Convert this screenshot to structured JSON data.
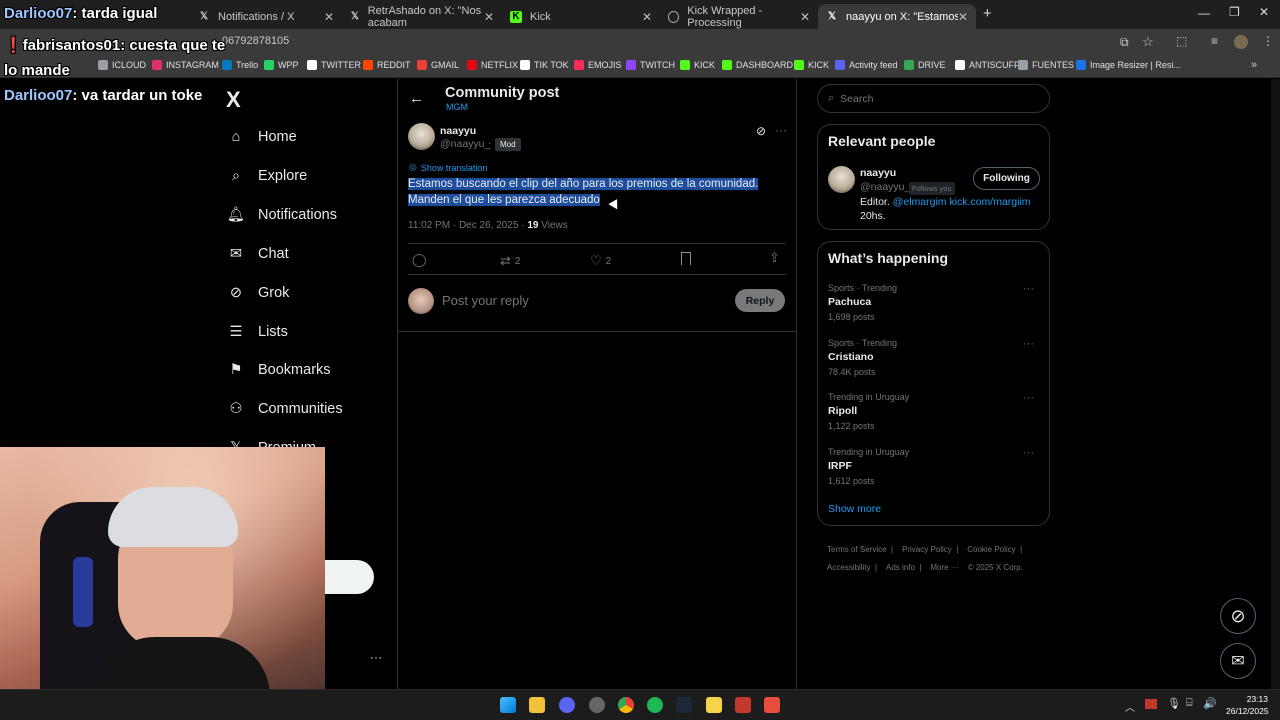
{
  "browser": {
    "tabs": [
      {
        "title": "Notifications / X",
        "icon": "x-icon"
      },
      {
        "title": "RetrAshado on X: \"Nos acabam",
        "icon": "x-icon"
      },
      {
        "title": "Kick",
        "icon": "kick-icon"
      },
      {
        "title": "Kick Wrapped - Processing",
        "icon": "globe-icon"
      },
      {
        "title": "naayyu on X: \"Estamos buscand",
        "icon": "x-icon"
      }
    ],
    "new_tab": "+",
    "url": "06792878105",
    "bookmarks": [
      {
        "label": "ICLOUD",
        "color": "#9aa0a6"
      },
      {
        "label": "INSTAGRAM",
        "color": "#e1306c"
      },
      {
        "label": "Trello",
        "color": "#0079bf"
      },
      {
        "label": "WPP",
        "color": "#25d366"
      },
      {
        "label": "TWITTER",
        "color": "#ffffff"
      },
      {
        "label": "REDDIT",
        "color": "#ff4500"
      },
      {
        "label": "GMAIL",
        "color": "#ea4335"
      },
      {
        "label": "NETFLIX",
        "color": "#e50914"
      },
      {
        "label": "TIK TOK",
        "color": "#ffffff"
      },
      {
        "label": "EMOJIS",
        "color": "#ff2d55"
      },
      {
        "label": "TWITCH",
        "color": "#9146ff"
      },
      {
        "label": "KICK",
        "color": "#53fc18"
      },
      {
        "label": "DASHBOARD",
        "color": "#53fc18"
      },
      {
        "label": "KICK",
        "color": "#53fc18"
      },
      {
        "label": "Activity feed",
        "color": "#5865f2"
      },
      {
        "label": "DRIVE",
        "color": "#34a853"
      },
      {
        "label": "ANTISCUFF",
        "color": "#ffffff"
      },
      {
        "label": "FUENTES",
        "color": "#9aa0a6"
      },
      {
        "label": "Image Resizer | Resi...",
        "color": "#1a73e8"
      }
    ]
  },
  "chat_overlay": [
    {
      "user": "Darlioo07",
      "message": "tarda igual"
    },
    {
      "user": "fabrisantos01",
      "message": "cuesta que te lo mande"
    },
    {
      "user": "Darlioo07",
      "message": "va tardar un toke"
    }
  ],
  "sidebar": {
    "logo": "X",
    "items": [
      {
        "label": "Home",
        "icon": "home-icon"
      },
      {
        "label": "Explore",
        "icon": "search-icon"
      },
      {
        "label": "Notifications",
        "icon": "bell-icon"
      },
      {
        "label": "Chat",
        "icon": "mail-icon"
      },
      {
        "label": "Grok",
        "icon": "grok-icon"
      },
      {
        "label": "Lists",
        "icon": "list-icon"
      },
      {
        "label": "Bookmarks",
        "icon": "bookmark-icon"
      },
      {
        "label": "Communities",
        "icon": "people-icon"
      },
      {
        "label": "Premium",
        "icon": "x-icon"
      }
    ],
    "more": "···"
  },
  "post": {
    "header_title": "Community post",
    "community": "MGM",
    "author_name": "naayyu",
    "author_handle": "@naayyu_",
    "author_sep": "·",
    "badge": "Mod",
    "show_translation": "Show translation",
    "text_line1": "Estamos buscando el clip del año para los premios de la comunidad.",
    "text_line2": "Manden el que les parezca adecuado",
    "time": "11:02 PM · Dec 26, 2025 ·",
    "views_count": "19",
    "views_label": "Views",
    "reposts": "2",
    "likes": "2",
    "reply_placeholder": "Post your reply",
    "reply_button": "Reply"
  },
  "right": {
    "search_placeholder": "Search",
    "relevant_title": "Relevant people",
    "person": {
      "name": "naayyu",
      "handle": "@naayyu_",
      "follows_you": "Follows you",
      "button": "Following",
      "bio_prefix": "Editor.",
      "bio_link": "@elmargim kick.com/margiim",
      "bio_line2": "20hs."
    },
    "happening_title": "What’s happening",
    "trends": [
      {
        "meta": "Sports · Trending",
        "name": "Pachuca",
        "count": "1,698 posts"
      },
      {
        "meta": "Sports · Trending",
        "name": "Cristiano",
        "count": "78.4K posts"
      },
      {
        "meta": "Trending in Uruguay",
        "name": "Ripoll",
        "count": "1,122 posts"
      },
      {
        "meta": "Trending in Uruguay",
        "name": "IRPF",
        "count": "1,612 posts"
      }
    ],
    "show_more": "Show more",
    "footer": {
      "terms": "Terms of Service",
      "privacy": "Privacy Policy",
      "cookie": "Cookie Policy",
      "accessibility": "Accessibility",
      "ads": "Ads info",
      "more": "More ···",
      "copyright": "© 2025 X Corp."
    }
  },
  "taskbar": {
    "time": "23:13",
    "date": "26/12/2025"
  }
}
